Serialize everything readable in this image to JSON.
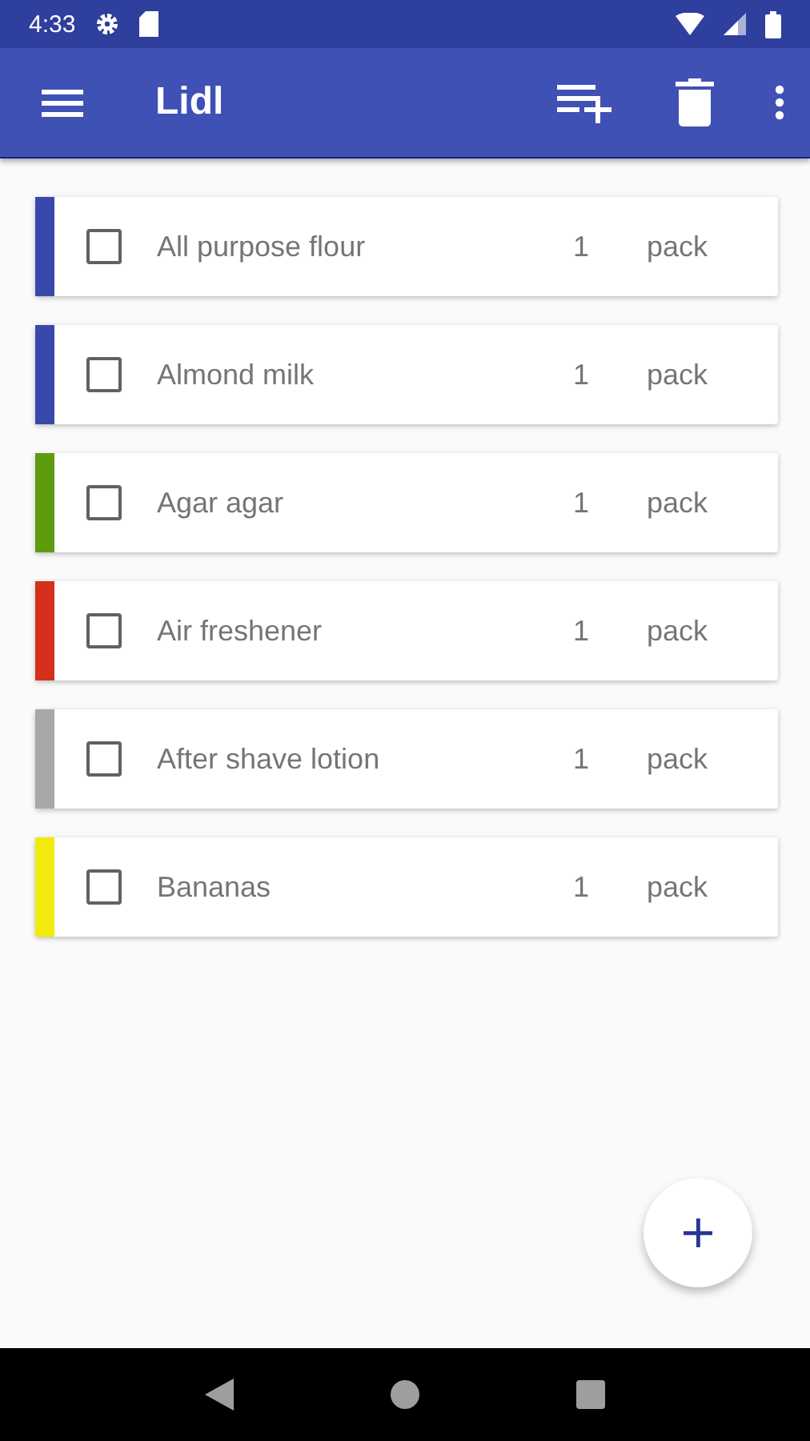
{
  "status_bar": {
    "time": "4:33"
  },
  "app_bar": {
    "title": "Lidl"
  },
  "items": [
    {
      "name": "All purpose flour",
      "quantity": "1",
      "unit": "pack",
      "checked": false,
      "color": "#3949ab"
    },
    {
      "name": "Almond milk",
      "quantity": "1",
      "unit": "pack",
      "checked": false,
      "color": "#3949ab"
    },
    {
      "name": "Agar agar",
      "quantity": "1",
      "unit": "pack",
      "checked": false,
      "color": "#5e9a0e"
    },
    {
      "name": "Air freshener",
      "quantity": "1",
      "unit": "pack",
      "checked": false,
      "color": "#d5301b"
    },
    {
      "name": "After shave lotion",
      "quantity": "1",
      "unit": "pack",
      "checked": false,
      "color": "#a8a8a8"
    },
    {
      "name": "Bananas",
      "quantity": "1",
      "unit": "pack",
      "checked": false,
      "color": "#f2ea0c"
    }
  ]
}
